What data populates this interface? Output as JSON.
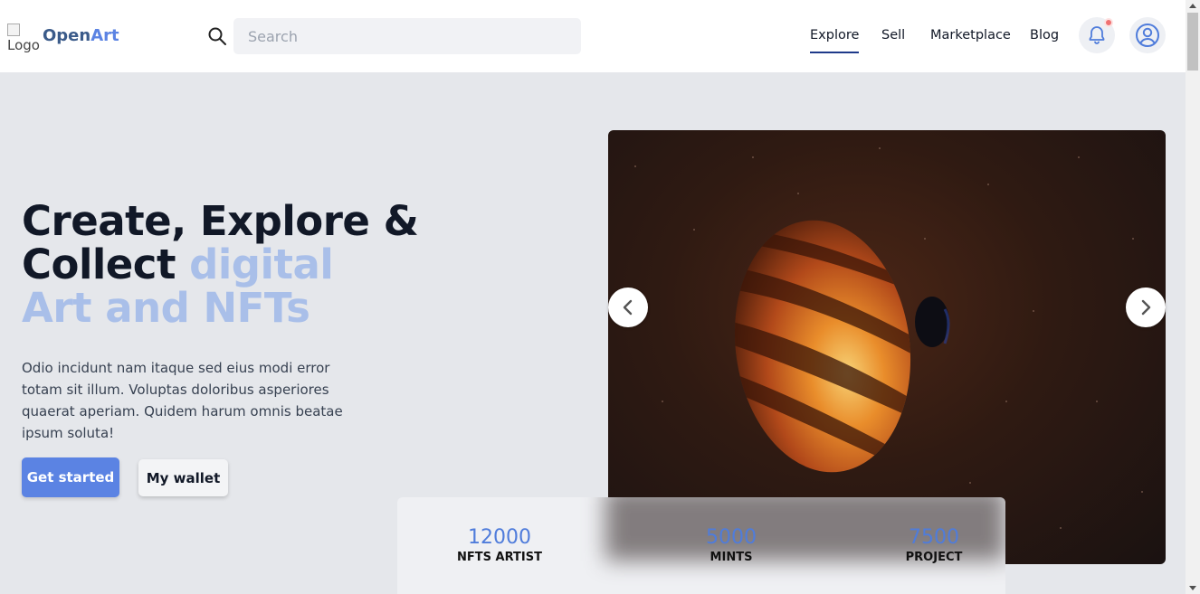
{
  "navbar": {
    "logo_alt": "Logo",
    "brand_part1": "Open",
    "brand_part2": "Art",
    "search_placeholder": "Search",
    "links": [
      {
        "label": "Explore",
        "active": true
      },
      {
        "label": "Sell",
        "active": false
      },
      {
        "label": "Marketplace",
        "active": false
      },
      {
        "label": "Blog",
        "active": false
      }
    ],
    "notification_icon": "bell-icon",
    "profile_icon": "user-circle-icon"
  },
  "hero": {
    "headline_line1": "Create, Explore &",
    "headline_line2_dark": "Collect ",
    "headline_line2_light": "digital",
    "headline_line3": "Art and NFTs",
    "description": "Odio incidunt nam itaque sed eius modi error totam sit illum. Voluptas doloribus asperiores quaerat aperiam. Quidem harum omnis beatae ipsum soluta!",
    "primary_button": "Get started",
    "secondary_button": "My wallet"
  },
  "carousel": {
    "prev_icon": "chevron-left-icon",
    "next_icon": "chevron-right-icon"
  },
  "stats": [
    {
      "value": "12000",
      "label": "NFTS ARTIST"
    },
    {
      "value": "5000",
      "label": "MINTS"
    },
    {
      "value": "7500",
      "label": "PROJECT"
    }
  ],
  "colors": {
    "accent": "#5b83e3",
    "headline_highlight": "#a9bfe9",
    "stat_value": "#4f7cdb",
    "notification_dot": "#f07171"
  }
}
